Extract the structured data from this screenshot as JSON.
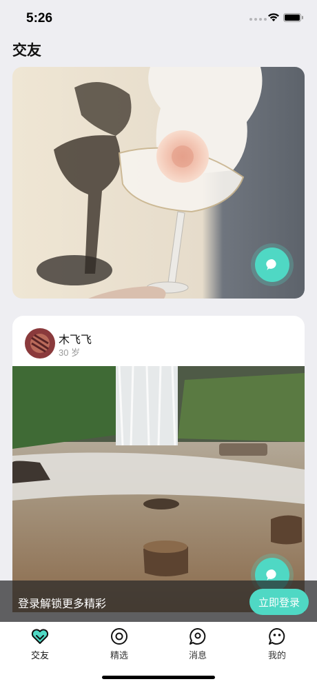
{
  "status_bar": {
    "time": "5:26"
  },
  "page_title": "交友",
  "card2": {
    "user_name": "木飞飞",
    "user_age": "30 岁"
  },
  "login_banner": {
    "text": "登录解锁更多精彩",
    "button_label": "立即登录"
  },
  "tabs": [
    {
      "label": "交友",
      "icon": "heart-icon",
      "active": true
    },
    {
      "label": "精选",
      "icon": "target-icon",
      "active": false
    },
    {
      "label": "消息",
      "icon": "chat-bubble-icon",
      "active": false
    },
    {
      "label": "我的",
      "icon": "smiley-icon",
      "active": false
    }
  ],
  "colors": {
    "accent": "#4fd8c4",
    "background": "#eeeef2"
  }
}
